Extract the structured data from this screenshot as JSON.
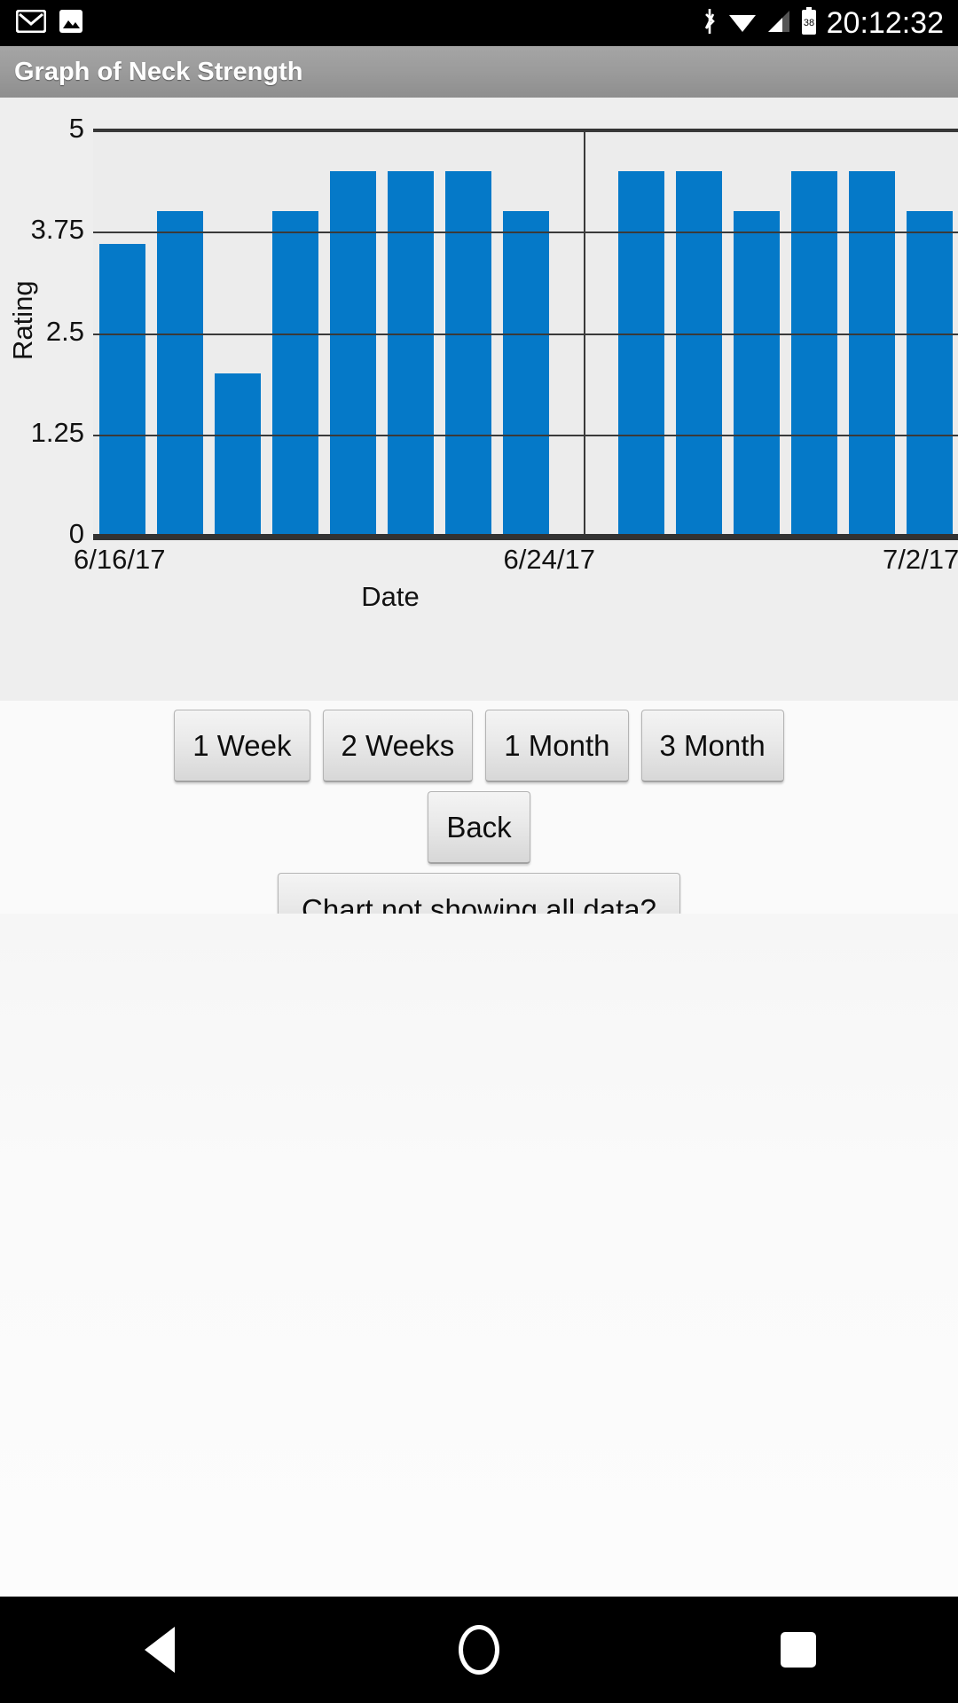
{
  "status_bar": {
    "icons_left": [
      "gmail-icon",
      "photos-icon"
    ],
    "icons_right": [
      "bluetooth-icon",
      "wifi-icon",
      "cell-signal-icon",
      "battery-icon"
    ],
    "battery_level": "38",
    "clock": "20:12:32"
  },
  "action_bar": {
    "title": "Graph of Neck Strength"
  },
  "chart_data": {
    "type": "bar",
    "title": "",
    "xlabel": "Date",
    "ylabel": "Rating",
    "ylim": [
      0,
      5
    ],
    "y_ticks": [
      "0",
      "1.25",
      "2.5",
      "3.75",
      "5"
    ],
    "x_ticks": [
      "6/16/17",
      "6/24/17",
      "7/2/17"
    ],
    "x_tick_clipped": "7/2/17",
    "grid": true,
    "bar_color": "#0579c8",
    "plot_background": "#ececec",
    "categories": [
      "6/16/17",
      "6/17/17",
      "6/18/17",
      "6/19/17",
      "6/20/17",
      "6/21/17",
      "6/22/17",
      "6/23/17",
      "6/24/17",
      "6/25/17",
      "6/26/17",
      "6/27/17",
      "6/28/17",
      "6/29/17",
      "6/30/17"
    ],
    "values": [
      3.6,
      4.0,
      2.0,
      4.0,
      4.5,
      4.5,
      4.5,
      4.0,
      null,
      4.5,
      4.5,
      4.0,
      4.5,
      4.5,
      4.0
    ]
  },
  "controls": {
    "range_buttons": [
      {
        "label": "1 Week"
      },
      {
        "label": "2 Weeks"
      },
      {
        "label": "1 Month"
      },
      {
        "label": "3 Month"
      }
    ],
    "back_label": "Back",
    "help_label": "Chart not showing all data?"
  },
  "nav_bar": {
    "back": "back-triangle-icon",
    "home": "home-circle-icon",
    "recents": "recents-square-icon"
  }
}
